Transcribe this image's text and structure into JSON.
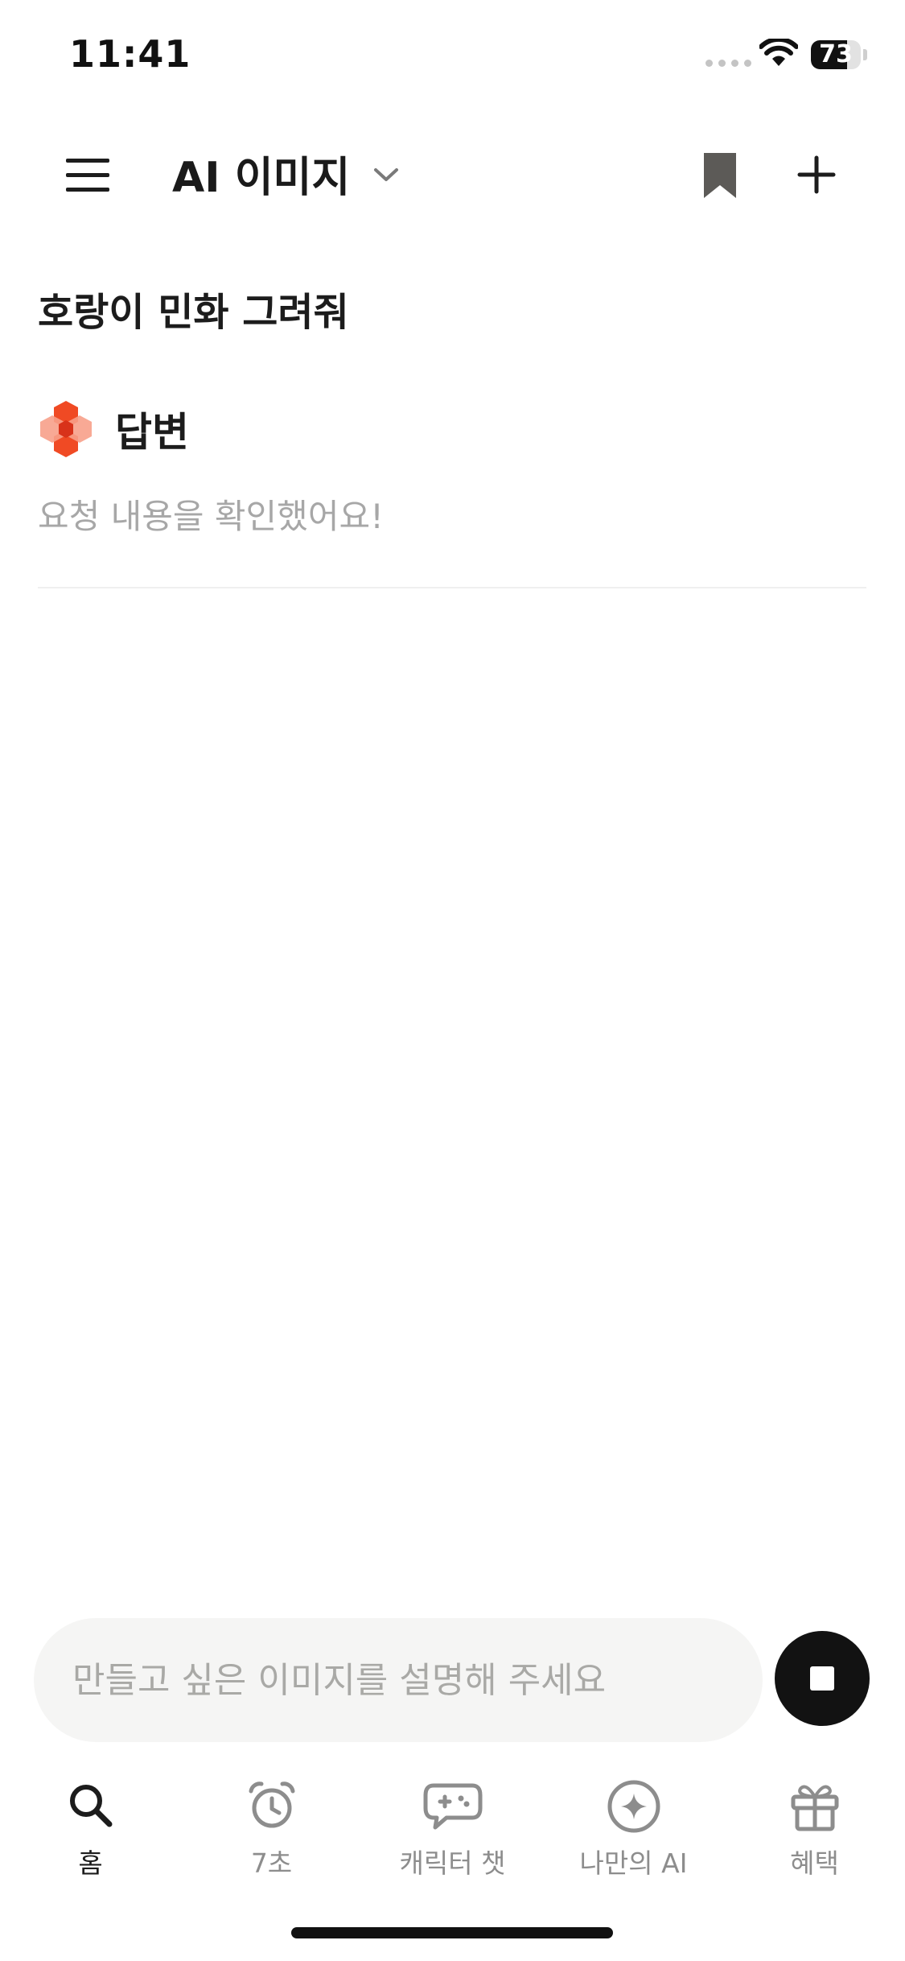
{
  "status_bar": {
    "time": "11:41",
    "battery_percent": "73",
    "battery_level": 0.73
  },
  "header": {
    "title": "AI 이미지",
    "icons": {
      "menu": "menu-icon",
      "dropdown": "chevron-down-icon",
      "bookmark": "bookmark-icon",
      "new_chat": "plus-icon"
    }
  },
  "conversation": {
    "question": "호랑이 민화 그려줘",
    "answer_label": "답변",
    "answer_status": "요청 내용을 확인했어요!"
  },
  "composer": {
    "placeholder": "만들고 싶은 이미지를 설명해 주세요",
    "value": "",
    "stop_icon": "stop-icon"
  },
  "tabs": [
    {
      "label": "홈",
      "icon": "search-icon",
      "active": true
    },
    {
      "label": "7초",
      "icon": "alarm-clock-icon",
      "active": false
    },
    {
      "label": "캐릭터 챗",
      "icon": "gamepad-chat-icon",
      "active": false
    },
    {
      "label": "나만의 AI",
      "icon": "sparkle-circle-icon",
      "active": false
    },
    {
      "label": "혜택",
      "icon": "gift-icon",
      "active": false
    }
  ],
  "colors": {
    "accent": "#f04a24",
    "text_primary": "#1c1c1c",
    "text_muted": "#a7a7a7",
    "input_background": "#f5f5f4",
    "tab_inactive": "#8d8d8d"
  }
}
